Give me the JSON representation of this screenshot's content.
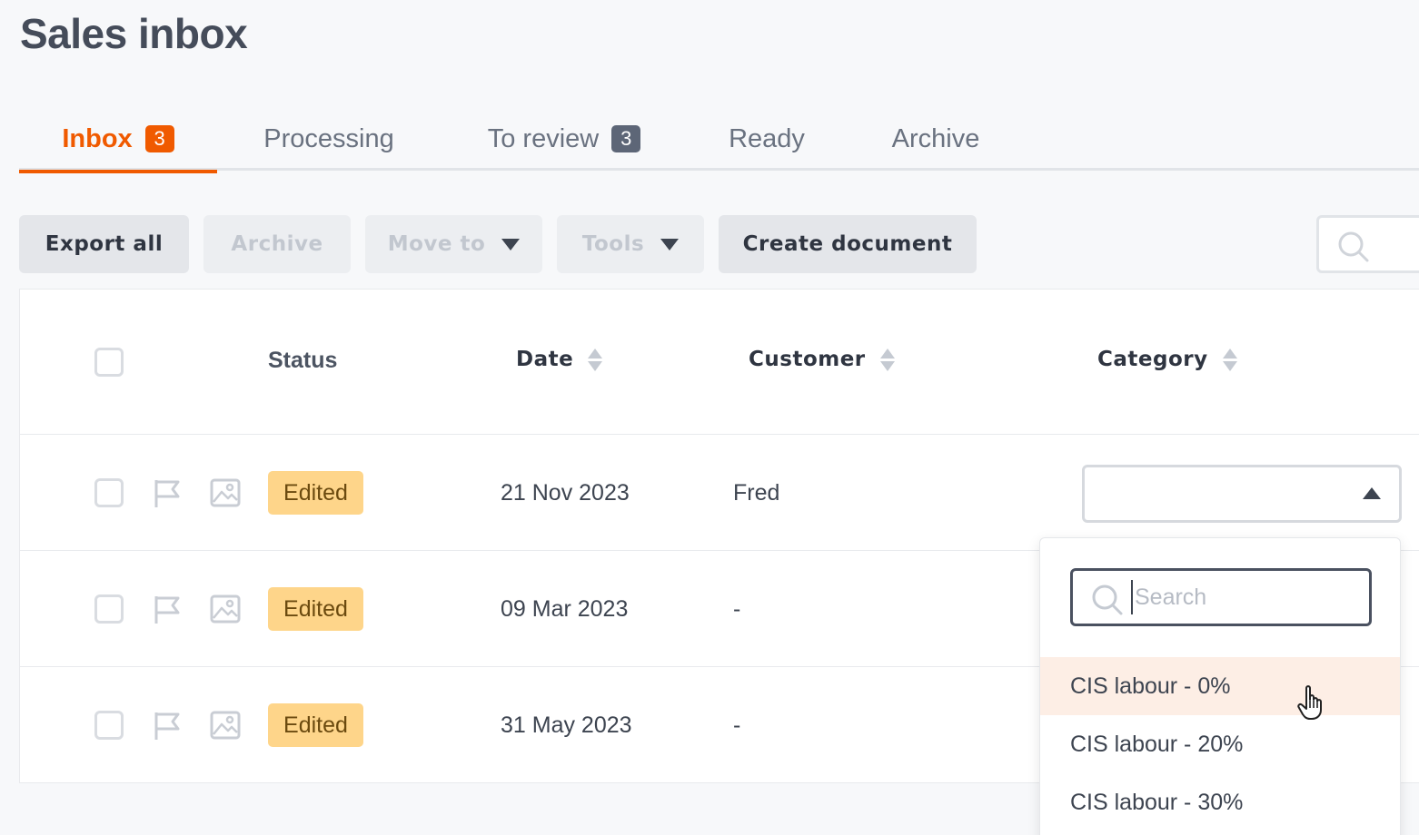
{
  "page": {
    "title": "Sales inbox"
  },
  "tabs": [
    {
      "label": "Inbox",
      "badge": "3",
      "active": true
    },
    {
      "label": "Processing"
    },
    {
      "label": "To review",
      "badge": "3"
    },
    {
      "label": "Ready"
    },
    {
      "label": "Archive"
    }
  ],
  "toolbar": {
    "export_all": "Export all",
    "archive": "Archive",
    "move_to": "Move to",
    "tools": "Tools",
    "create_document": "Create document",
    "search_icon": "search-icon"
  },
  "table": {
    "headers": {
      "status": "Status",
      "date": "Date",
      "customer": "Customer",
      "category": "Category"
    },
    "rows": [
      {
        "status": "Edited",
        "date": "21 Nov 2023",
        "customer": "Fred",
        "category": ""
      },
      {
        "status": "Edited",
        "date": "09 Mar 2023",
        "customer": "-"
      },
      {
        "status": "Edited",
        "date": "31 May 2023",
        "customer": "-"
      }
    ]
  },
  "category_dropdown": {
    "search_placeholder": "Search",
    "options": [
      "CIS labour - 0%",
      "CIS labour - 20%",
      "CIS labour - 30%"
    ],
    "hovered_option": "CIS labour - 0%"
  },
  "colors": {
    "accent": "#f05a00",
    "badge_grey": "#5d6677",
    "edited_badge": "#fed58a",
    "hover_row": "#fdeee5"
  }
}
